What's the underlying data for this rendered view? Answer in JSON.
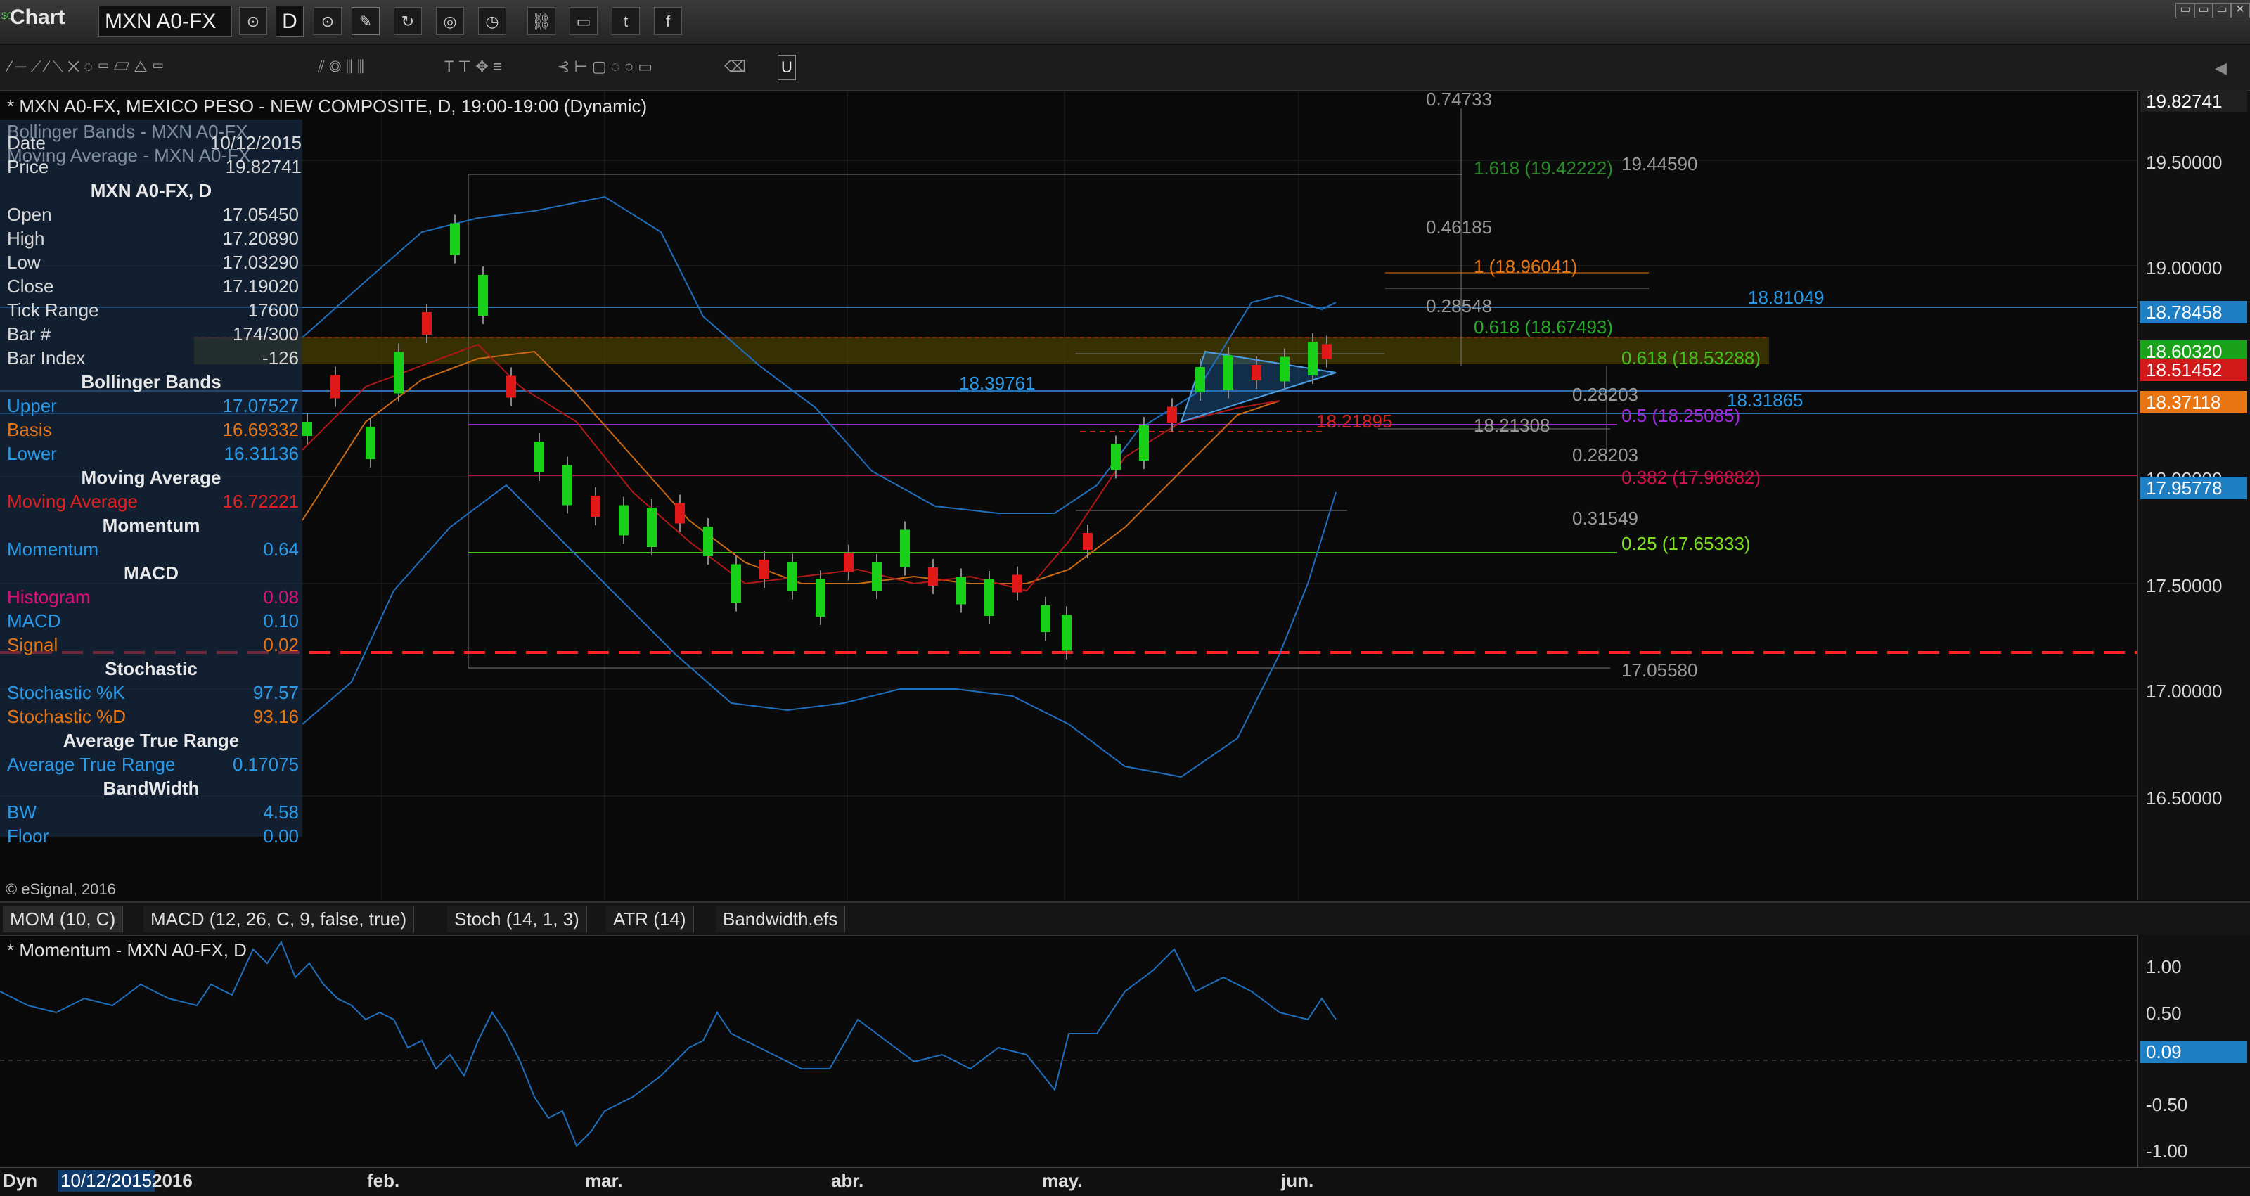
{
  "titlebar": {
    "app_title": "Chart",
    "symbol": "MXN A0-FX",
    "interval": "D",
    "window_buttons": [
      "▭",
      "▭",
      "▭",
      "✕"
    ]
  },
  "chart": {
    "title": "* MXN A0-FX, MEXICO PESO - NEW COMPOSITE, D, 19:00-19:00 (Dynamic)",
    "copyright": "© eSignal, 2016",
    "price_labels": [
      "19.50000",
      "19.00000",
      "18.00000",
      "17.50000",
      "17.00000",
      "16.50000"
    ],
    "price_tags": [
      {
        "text": "19.82741",
        "color": "#202020"
      },
      {
        "text": "18.78458",
        "color": "#1f7fc4"
      },
      {
        "text": "18.60320",
        "color": "#1aa31a"
      },
      {
        "text": "18.51452",
        "color": "#d21a1a"
      },
      {
        "text": "18.37118",
        "color": "#e87511"
      },
      {
        "text": "17.95778",
        "color": "#1f7fc4"
      }
    ],
    "annotations": {
      "fib_top": "0.74733",
      "fib_1618_a": "1.618 (19.42222)",
      "level_19445": "19.44590",
      "fib_046": "0.46185",
      "fib_1": "1 (18.96041)",
      "level_1881": "18.81049",
      "fib_0285": "0.28548",
      "fib_0618_a": "0.618 (18.67493)",
      "fib_0618_b": "0.618 (18.53288)",
      "level_18397": "18.39761",
      "fib_0282_a": "0.28203",
      "level_18318": "18.31865",
      "fib_05": "0.5 (18.25085)",
      "level_18218": "18.21895",
      "level_18213": "18.21308",
      "fib_0282_b": "0.28203",
      "fib_0382": "0.382 (17.96882)",
      "fib_0315": "0.31549",
      "fib_025": "0.25 (17.65333)",
      "level_17055": "17.05580"
    }
  },
  "data_window": {
    "ghost1": "Bollinger Bands - MXN A0-FX",
    "ghost2": "Moving Average - MXN A0-FX",
    "date": {
      "label": "Date",
      "value": "10/12/2015"
    },
    "price": {
      "label": "Price",
      "value": "19.82741"
    },
    "symbol_head": "MXN A0-FX, D",
    "rows": [
      {
        "label": "Open",
        "value": "17.05450"
      },
      {
        "label": "High",
        "value": "17.20890"
      },
      {
        "label": "Low",
        "value": "17.03290"
      },
      {
        "label": "Close",
        "value": "17.19020"
      },
      {
        "label": "Tick Range",
        "value": "17600"
      },
      {
        "label": "Bar #",
        "value": "174/300"
      },
      {
        "label": "Bar Index",
        "value": "-126"
      }
    ],
    "bb_head": "Bollinger Bands",
    "bb": [
      {
        "label": "Upper",
        "value": "17.07527"
      },
      {
        "label": "Basis",
        "value": "16.69332"
      },
      {
        "label": "Lower",
        "value": "16.31136"
      }
    ],
    "ma_head": "Moving Average",
    "ma": {
      "label": "Moving Average",
      "value": "16.72221"
    },
    "mom_head": "Momentum",
    "mom": {
      "label": "Momentum",
      "value": "0.64"
    },
    "macd_head": "MACD",
    "macd": [
      {
        "label": "Histogram",
        "value": "0.08"
      },
      {
        "label": "MACD",
        "value": "0.10"
      },
      {
        "label": "Signal",
        "value": "0.02"
      }
    ],
    "stoch_head": "Stochastic",
    "stoch": [
      {
        "label": "Stochastic %K",
        "value": "97.57"
      },
      {
        "label": "Stochastic %D",
        "value": "93.16"
      }
    ],
    "atr_head": "Average True Range",
    "atr": {
      "label": "Average True Range",
      "value": "0.17075"
    },
    "bw_head": "BandWidth",
    "bw": [
      {
        "label": "BW",
        "value": "4.58"
      },
      {
        "label": "Floor",
        "value": "0.00"
      }
    ]
  },
  "tabs": [
    "MOM (10, C)",
    "MACD (12, 26, C, 9, false, true)",
    "Stoch (14, 1, 3)",
    "ATR (14)",
    "Bandwidth.efs"
  ],
  "momentum": {
    "title": "* Momentum - MXN A0-FX, D",
    "axis_labels": [
      "1.00",
      "0.50",
      "-0.50",
      "-1.00"
    ],
    "current": "0.09"
  },
  "time_axis": {
    "left_label": "Dyn",
    "cursor_date": "10/12/2015",
    "year": "2016",
    "months": [
      "feb.",
      "mar.",
      "abr.",
      "may.",
      "jun."
    ]
  }
}
